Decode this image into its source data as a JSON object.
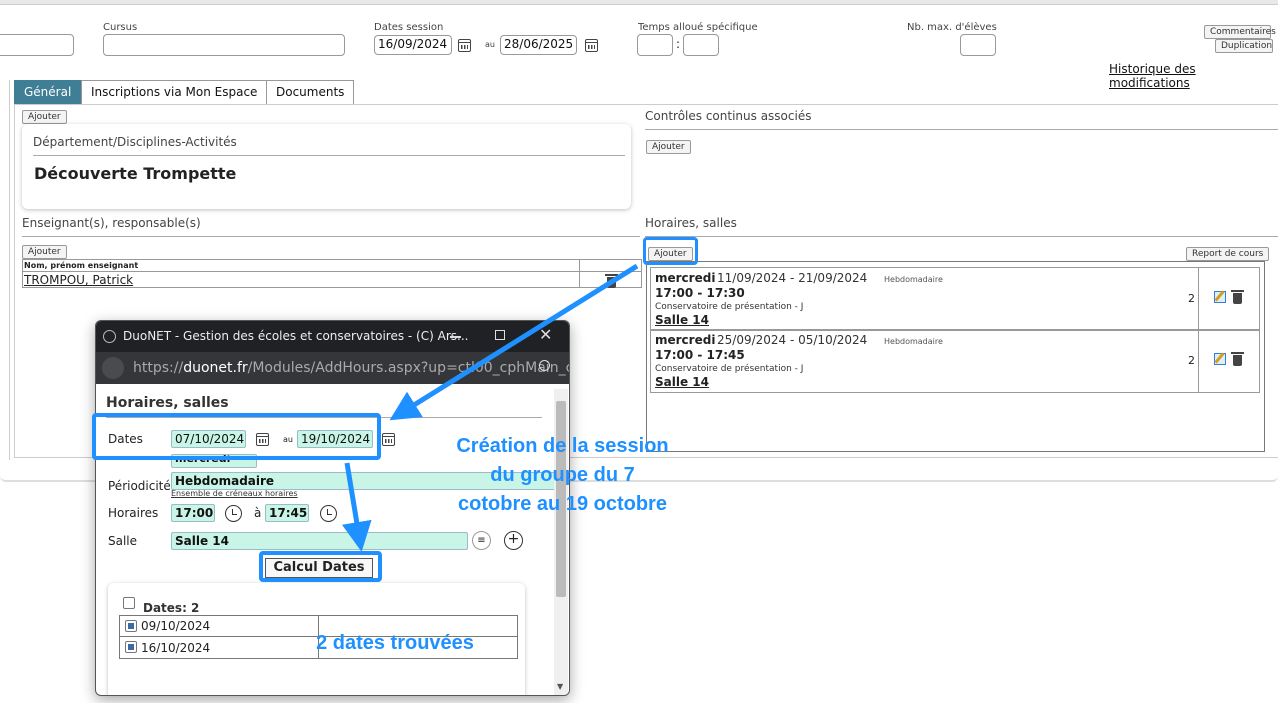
{
  "top_form": {
    "cursus_label": "Cursus",
    "dates_label": "Dates session",
    "date_start": "16/09/2024",
    "date_sep": "au",
    "date_end": "28/06/2025",
    "time_label": "Temps alloué spécifique",
    "time_sep": ":",
    "max_label": "Nb. max. d'élèves",
    "btn_comments": "Commentaires",
    "btn_duplicate": "Duplication",
    "history_link": "Historique des modifications"
  },
  "tabs": [
    {
      "label": "Général",
      "active": true
    },
    {
      "label": "Inscriptions via Mon Espace",
      "active": false
    },
    {
      "label": "Documents",
      "active": false
    }
  ],
  "general": {
    "add_label": "Ajouter",
    "dept_title": "Département/Disciplines-Activités",
    "dept_value": "Découverte Trompette",
    "teachers_title": "Enseignant(s), responsable(s)",
    "teacher_col": "Nom, prénom enseignant",
    "teacher_name": "TROMPOU, Patrick",
    "cc_title": "Contrôles continus associés",
    "hours_title": "Horaires, salles",
    "report_label": "Report de cours"
  },
  "schedules": [
    {
      "day": "mercredi",
      "range": "11/09/2024 - 21/09/2024",
      "freq": "Hebdomadaire",
      "time": "17:00 - 17:30",
      "school": "Conservatoire de présentation - J",
      "room": "Salle 14",
      "count": "2"
    },
    {
      "day": "mercredi",
      "range": "25/09/2024 - 05/10/2024",
      "freq": "Hebdomadaire",
      "time": "17:00 - 17:45",
      "school": "Conservatoire de présentation - J",
      "room": "Salle 14",
      "count": "2"
    }
  ],
  "popup": {
    "window_title": "DuoNET - Gestion des écoles et conservatoires - (C) Ars...",
    "url_prefix": "https://",
    "url_host": "duonet.fr",
    "url_path": "/Modules/AddHours.aspx?up=ctl00_cphMain_c",
    "heading": "Horaires, salles",
    "dates_label": "Dates",
    "date_start": "07/10/2024",
    "date_sep": "au",
    "date_end": "19/10/2024",
    "day_value": "mercredi",
    "period_label": "Périodicité",
    "period_value": "Hebdomadaire",
    "period_link": "Ensemble de créneaux horaires",
    "hours_label": "Horaires",
    "hour_start": "17:00",
    "hour_sep": "à",
    "hour_end": "17:45",
    "room_label": "Salle",
    "room_value": "Salle 14",
    "calc_button": "Calcul Dates",
    "dates_count": "Dates: 2",
    "dates": [
      "09/10/2024",
      "16/10/2024"
    ]
  },
  "annotations": {
    "creation_l1": "Création de la session",
    "creation_l2": "du groupe du 7",
    "creation_l3": "cotobre au 19 octobre",
    "found": "2 dates trouvées"
  },
  "colors": {
    "accent": "#1e90ff",
    "tab_active": "#3f7f96",
    "highlight_input": "#c9f5e6",
    "popup_titlebar": "#202124"
  }
}
